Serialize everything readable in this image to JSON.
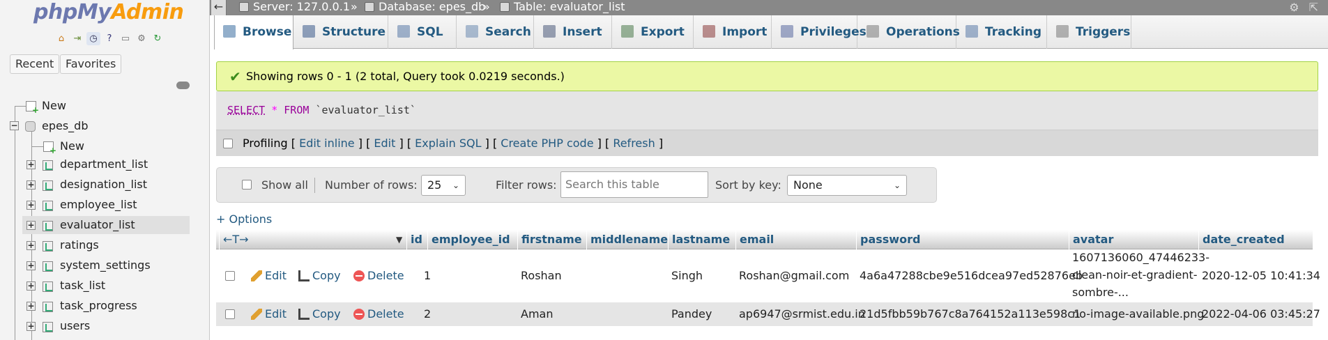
{
  "app": {
    "logo_php": "php",
    "logo_my": "My",
    "logo_admin": "Admin"
  },
  "nav": {
    "recent": "Recent",
    "favorites": "Favorites",
    "tree": {
      "new_top": "New",
      "db": "epes_db",
      "new_db": "New",
      "tables": [
        "department_list",
        "designation_list",
        "employee_list",
        "evaluator_list",
        "ratings",
        "system_settings",
        "task_list",
        "task_progress",
        "users"
      ],
      "selected": "evaluator_list"
    }
  },
  "breadcrumb": {
    "server": "Server: 127.0.0.1",
    "sep": "»",
    "database": "Database: epes_db",
    "table": "Table: evaluator_list"
  },
  "tabs": [
    {
      "label": "Browse",
      "icon": "browse-icon"
    },
    {
      "label": "Structure",
      "icon": "structure-icon"
    },
    {
      "label": "SQL",
      "icon": "sql-icon"
    },
    {
      "label": "Search",
      "icon": "search-icon"
    },
    {
      "label": "Insert",
      "icon": "insert-icon"
    },
    {
      "label": "Export",
      "icon": "export-icon"
    },
    {
      "label": "Import",
      "icon": "import-icon"
    },
    {
      "label": "Privileges",
      "icon": "privileges-icon"
    },
    {
      "label": "Operations",
      "icon": "operations-icon"
    },
    {
      "label": "Tracking",
      "icon": "tracking-icon"
    },
    {
      "label": "Triggers",
      "icon": "triggers-icon"
    }
  ],
  "message": {
    "success": "Showing rows 0 - 1 (2 total, Query took 0.0219 seconds.)"
  },
  "sql": {
    "select": "SELECT",
    "star": "*",
    "from": "FROM",
    "table": "`evaluator_list`"
  },
  "profiling": {
    "label": "Profiling",
    "edit_inline": "Edit inline",
    "edit": "Edit",
    "explain": "Explain SQL",
    "php": "Create PHP code",
    "refresh": "Refresh",
    "lb": "[",
    "rb": "]"
  },
  "navform": {
    "show_all": "Show all",
    "rows_label": "Number of rows:",
    "rows_value": "25",
    "filter_label": "Filter rows:",
    "filter_placeholder": "Search this table",
    "sort_label": "Sort by key:",
    "sort_value": "None"
  },
  "options_link": "+ Options",
  "columns": [
    "id",
    "employee_id",
    "firstname",
    "middlename",
    "lastname",
    "email",
    "password",
    "avatar",
    "date_created"
  ],
  "arrows": "←T→",
  "actions": {
    "edit": "Edit",
    "copy": "Copy",
    "delete": "Delete"
  },
  "rows": [
    {
      "id": "1",
      "employee_id": "",
      "firstname": "Roshan",
      "middlename": "",
      "lastname": "Singh",
      "email": "Roshan@gmail.com",
      "password": "4a6a47288cbe9e516dcea97ed52876eb",
      "avatar_l1": "1607136060_47446233-",
      "avatar_l2": "clean-noir-et-gradient-",
      "avatar_l3": "sombre-...",
      "date_created": "2020-12-05 10:41:34"
    },
    {
      "id": "2",
      "employee_id": "",
      "firstname": "Aman",
      "middlename": "",
      "lastname": "Pandey",
      "email": "ap6947@srmist.edu.in",
      "password": "21d5fbb59b767c8a764152a113e598c1",
      "avatar_l1": "no-image-available.png",
      "date_created": "2022-04-06 03:45:27"
    }
  ],
  "colors": {
    "accent": "#235a81",
    "success_bg": "#ebf8a4",
    "logo_blue": "#6c78af",
    "logo_orange": "#f89c0e"
  }
}
